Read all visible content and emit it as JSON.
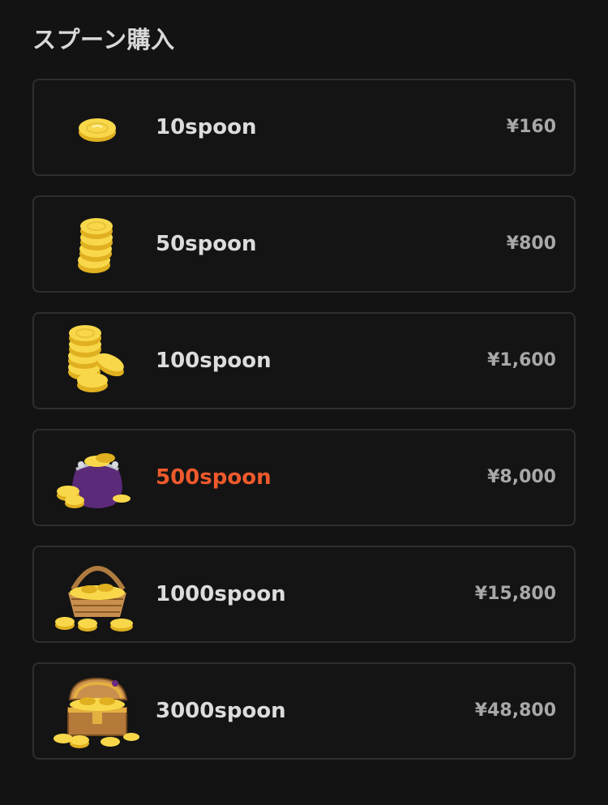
{
  "header": {
    "title": "スプーン購入"
  },
  "colors": {
    "highlight": "#ef5a2c",
    "border": "#2e2e2e",
    "background": "#131313"
  },
  "items": [
    {
      "amount": "10spoon",
      "price": "¥160",
      "icon": "single-coin-icon",
      "highlight": false
    },
    {
      "amount": "50spoon",
      "price": "¥800",
      "icon": "coin-stack-icon",
      "highlight": false
    },
    {
      "amount": "100spoon",
      "price": "¥1,600",
      "icon": "coin-piles-icon",
      "highlight": false
    },
    {
      "amount": "500spoon",
      "price": "¥8,000",
      "icon": "coin-purse-icon",
      "highlight": true
    },
    {
      "amount": "1000spoon",
      "price": "¥15,800",
      "icon": "coin-basket-icon",
      "highlight": false
    },
    {
      "amount": "3000spoon",
      "price": "¥48,800",
      "icon": "treasure-chest-icon",
      "highlight": false
    }
  ]
}
